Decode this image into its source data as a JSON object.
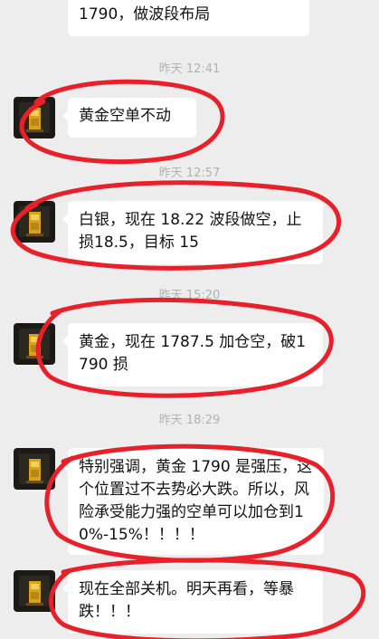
{
  "messages": [
    {
      "text": "1790，做波段布局"
    },
    {
      "time": "昨天 12:41",
      "text": "黄金空单不动"
    },
    {
      "time": "昨天 12:57",
      "text": "白银，现在 18.22 波段做空，止损18.5，目标 15"
    },
    {
      "time": "昨天 15:20",
      "text": "黄金，现在 1787.5 加仓空，破1790 损"
    },
    {
      "time": "昨天 18:29",
      "text": "特别强调，黄金 1790 是强压，这个位置过不去势必大跌。所以，风险承受能力强的空单可以加仓到10%-15%！！！！"
    },
    {
      "text": "现在全部关机。明天再看，等暴跌！！！"
    }
  ],
  "colors": {
    "background": "#ededed",
    "bubble": "#ffffff",
    "timestamp": "#b2b2b2",
    "annotation": "#e8202a"
  }
}
